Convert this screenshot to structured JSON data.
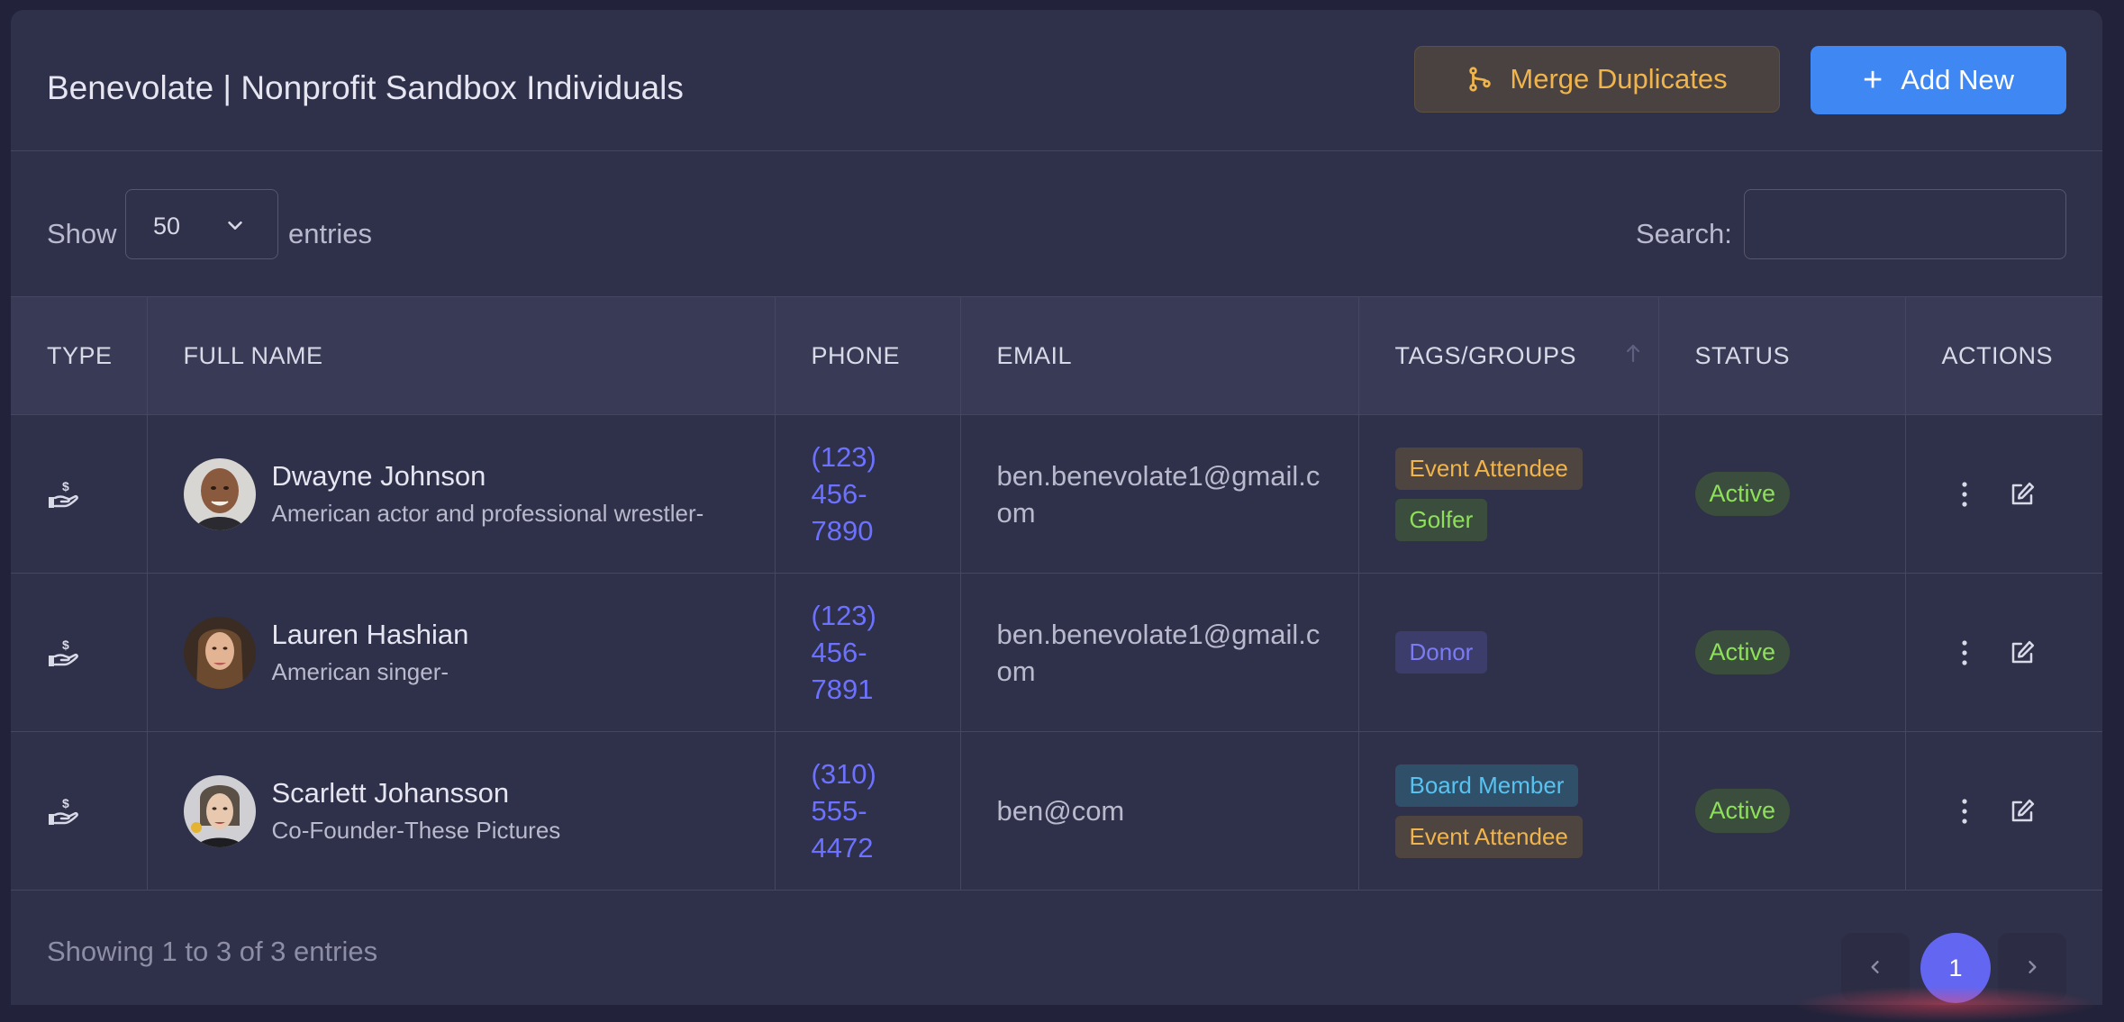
{
  "header": {
    "title": "Benevolate | Nonprofit Sandbox Individuals",
    "merge_label": "Merge Duplicates",
    "add_label": "Add New",
    "add_icon": "+"
  },
  "controls": {
    "show_label": "Show",
    "page_size": "50",
    "entries_label": "entries",
    "search_label": "Search:",
    "search_value": ""
  },
  "table": {
    "columns": [
      "TYPE",
      "FULL NAME",
      "PHONE",
      "EMAIL",
      "TAGS/GROUPS",
      "STATUS",
      "ACTIONS"
    ],
    "rows": [
      {
        "type_icon": "donor-hand-icon",
        "name": "Dwayne Johnson",
        "description": "American actor and professional wrestler-",
        "phone": "(123) 456-7890",
        "email": "ben.benevolate1@gmail.com",
        "tags": [
          {
            "label": "Event Attendee",
            "color": "#f0b44c",
            "bg": "#4f4540"
          },
          {
            "label": "Golfer",
            "color": "#8ee05a",
            "bg": "#3b4e3e"
          }
        ],
        "status": "Active"
      },
      {
        "type_icon": "donor-hand-icon",
        "name": "Lauren Hashian",
        "description": "American singer-",
        "phone": "(123) 456-7891",
        "email": "ben.benevolate1@gmail.com",
        "tags": [
          {
            "label": "Donor",
            "color": "#7b7cf4",
            "bg": "#3c3d6a"
          }
        ],
        "status": "Active"
      },
      {
        "type_icon": "donor-hand-icon",
        "name": "Scarlett Johansson",
        "description": "Co-Founder-These Pictures",
        "phone": "(310) 555-4472",
        "email": "ben@com",
        "tags": [
          {
            "label": "Board Member",
            "color": "#58c3f0",
            "bg": "#30506a"
          },
          {
            "label": "Event Attendee",
            "color": "#f0b44c",
            "bg": "#4f4540"
          }
        ],
        "status": "Active"
      }
    ]
  },
  "footer": {
    "info": "Showing 1 to 3 of 3 entries",
    "current_page": "1"
  },
  "colors": {
    "accent": "#6366f1",
    "primary_button": "#3f87f3",
    "merge_text": "#f0b44c",
    "phone_link": "#6c72ff",
    "status_active": "#8ee05a"
  }
}
